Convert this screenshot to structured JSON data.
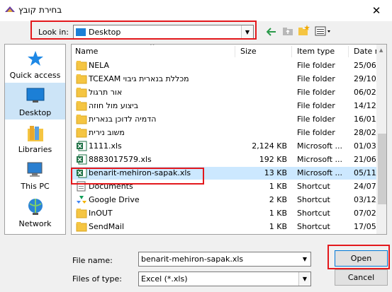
{
  "window": {
    "title": "בחירת קובץ",
    "close_symbol": "✕"
  },
  "toolbar": {
    "look_in_label": "Look in:",
    "look_in_value": "Desktop",
    "back_icon": "back-arrow-icon",
    "up_icon": "up-folder-icon",
    "new_folder_icon": "new-folder-icon",
    "view_icon": "view-menu-icon"
  },
  "places": [
    {
      "label": "Quick access",
      "icon": "star-icon"
    },
    {
      "label": "Desktop",
      "icon": "desktop-icon",
      "selected": true
    },
    {
      "label": "Libraries",
      "icon": "libraries-icon"
    },
    {
      "label": "This PC",
      "icon": "computer-icon"
    },
    {
      "label": "Network",
      "icon": "network-icon"
    }
  ],
  "columns": [
    {
      "label": "Name"
    },
    {
      "label": "Size"
    },
    {
      "label": "Item type"
    },
    {
      "label": "Date m"
    }
  ],
  "files": [
    {
      "name": "NELA",
      "size": "",
      "type": "File folder",
      "date": "25/06/",
      "icon": "folder",
      "rtl": false
    },
    {
      "name": "מכללת בנארית גיבוי TCEXAM",
      "size": "",
      "type": "File folder",
      "date": "29/10/",
      "icon": "folder",
      "rtl": true
    },
    {
      "name": "אור תרגול",
      "size": "",
      "type": "File folder",
      "date": "06/02/",
      "icon": "folder",
      "rtl": true
    },
    {
      "name": "ביצוע מול חוזה",
      "size": "",
      "type": "File folder",
      "date": "14/12/",
      "icon": "folder",
      "rtl": true
    },
    {
      "name": "הדמיה לדוכן בנארית",
      "size": "",
      "type": "File folder",
      "date": "16/01/",
      "icon": "folder",
      "rtl": true
    },
    {
      "name": "משוב נירית",
      "size": "",
      "type": "File folder",
      "date": "28/02/",
      "icon": "folder",
      "rtl": true
    },
    {
      "name": "1111.xls",
      "size": "2,124 KB",
      "type": "Microsoft ...",
      "date": "01/03/",
      "icon": "excel",
      "rtl": false
    },
    {
      "name": "8883017579.xls",
      "size": "192 KB",
      "type": "Microsoft ...",
      "date": "21/06/",
      "icon": "excel",
      "rtl": false
    },
    {
      "name": "benarit-mehiron-sapak.xls",
      "size": "13 KB",
      "type": "Microsoft ...",
      "date": "05/11/",
      "icon": "excel",
      "rtl": false,
      "selected": true
    },
    {
      "name": "Documents",
      "size": "1 KB",
      "type": "Shortcut",
      "date": "24/07/",
      "icon": "documents",
      "rtl": false
    },
    {
      "name": "Google Drive",
      "size": "2 KB",
      "type": "Shortcut",
      "date": "03/12/",
      "icon": "drive",
      "rtl": false
    },
    {
      "name": "InOUT",
      "size": "1 KB",
      "type": "Shortcut",
      "date": "07/02/",
      "icon": "folder",
      "rtl": false
    },
    {
      "name": "SendMail",
      "size": "1 KB",
      "type": "Shortcut",
      "date": "17/05/",
      "icon": "folder",
      "rtl": false
    }
  ],
  "bottom": {
    "file_name_label": "File name:",
    "file_name_value": "benarit-mehiron-sapak.xls",
    "file_type_label": "Files of type:",
    "file_type_value": "Excel (*.xls)",
    "open_label": "Open",
    "cancel_label": "Cancel"
  },
  "colors": {
    "highlight": "#e3181c",
    "selection": "#cce8ff",
    "folder": "#f5c542",
    "excel": "#1e7145"
  }
}
